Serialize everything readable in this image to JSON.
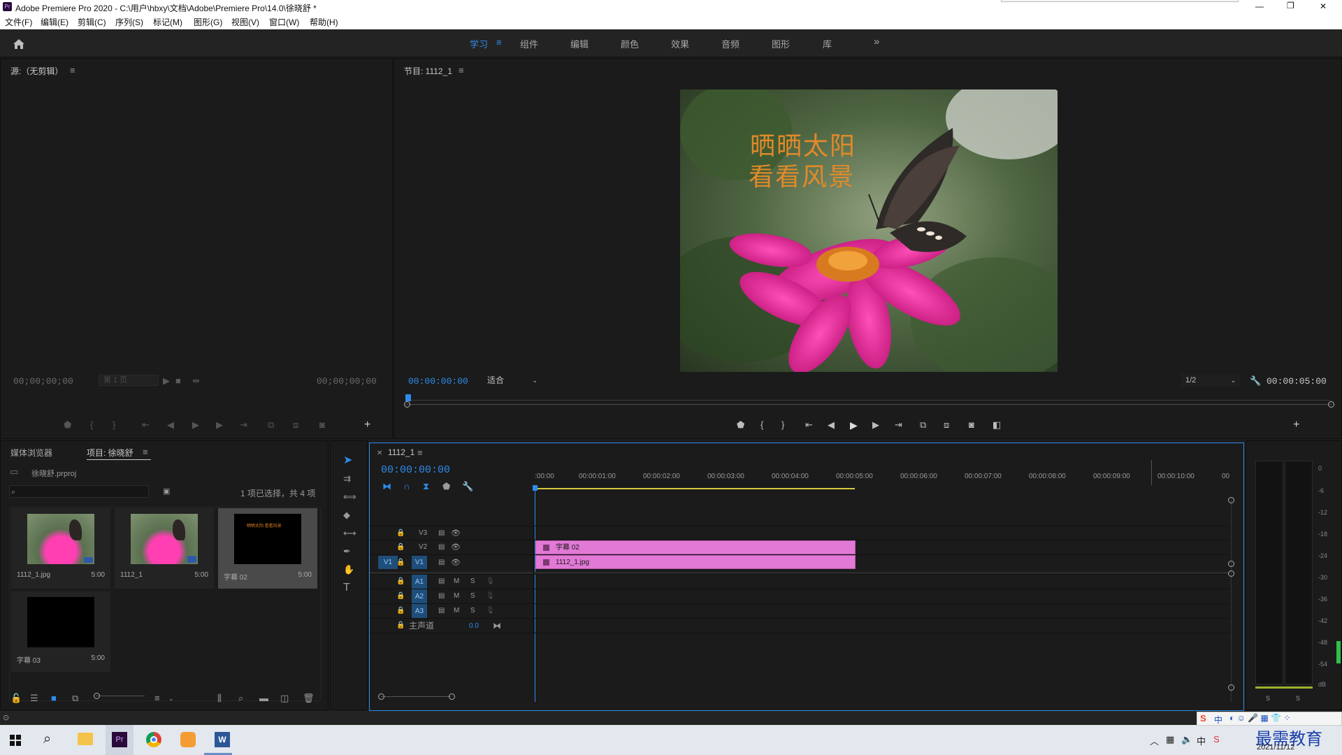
{
  "window": {
    "title": "Adobe Premiere Pro 2020 - C:\\用户\\hbxy\\文档\\Adobe\\Premiere Pro\\14.0\\徐晓舒 *",
    "minimize": "—",
    "restore": "❐",
    "close": "✕"
  },
  "menu": [
    "文件(F)",
    "编辑(E)",
    "剪辑(C)",
    "序列(S)",
    "标记(M)",
    "图形(G)",
    "视图(V)",
    "窗口(W)",
    "帮助(H)"
  ],
  "workspaces": {
    "active": "学习",
    "tabs": [
      "组件",
      "编辑",
      "颜色",
      "效果",
      "音频",
      "图形",
      "库"
    ],
    "more": "»"
  },
  "source": {
    "title": "源:（无剪辑）",
    "tc_in": "00;00;00;00",
    "page": "第 1 页",
    "tc_out": "00;00;00;00"
  },
  "program": {
    "title": "节目: 1112_1",
    "tc": "00:00:00:00",
    "fit": "适合",
    "resolution": "1/2",
    "duration": "00:00:05:00",
    "overlay_line1": "晒晒太阳",
    "overlay_line2": "看看风景"
  },
  "project": {
    "tab_media": "媒体浏览器",
    "tab_project": "项目: 徐晓舒",
    "file": "徐晓舒.prproj",
    "count": "1 项已选择，共 4 项",
    "items": [
      {
        "name": "1112_1.jpg",
        "dur": "5:00"
      },
      {
        "name": "1112_1",
        "dur": "5:00"
      },
      {
        "name": "字幕 02",
        "dur": "5:00"
      },
      {
        "name": "字幕 03",
        "dur": "5:00"
      }
    ],
    "thumb_text": "晒晒太阳 看看风景"
  },
  "timeline": {
    "seq": "1112_1",
    "tc": "00:00:00:00",
    "ruler": [
      ":00:00",
      "00:00:01:00",
      "00:00:02:00",
      "00:00:03:00",
      "00:00:04:00",
      "00:00:05:00",
      "00:00:06:00",
      "00:00:07:00",
      "00:00:08:00",
      "00:00:09:00",
      "00:00:10:00",
      "00"
    ],
    "video_tracks": [
      "V3",
      "V2",
      "V1"
    ],
    "audio_tracks": [
      "A1",
      "A2",
      "A3"
    ],
    "src_patch": "V1",
    "m": "M",
    "s": "S",
    "master": "主声道",
    "master_val": "0.0",
    "clip_v2": "字幕 02",
    "clip_v1": "1112_1.jpg"
  },
  "meters": {
    "labels": [
      "0",
      "-6",
      "-12",
      "-18",
      "-24",
      "-30",
      "-36",
      "-42",
      "-48",
      "-54",
      "dB"
    ],
    "solo": "S",
    "level": 0.1
  },
  "taskbar": {
    "date": "2021/11/12",
    "watermark": "最需教育",
    "ime": "中"
  },
  "colors": {
    "accent": "#2d8ceb",
    "clip": "#e279d6",
    "overlay_text": "#e08a2a"
  }
}
